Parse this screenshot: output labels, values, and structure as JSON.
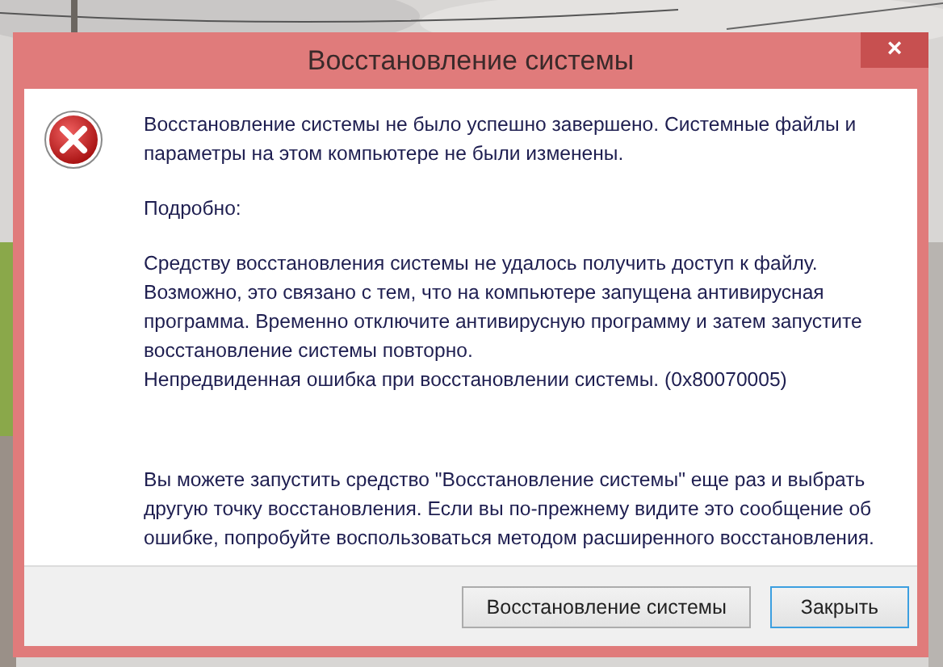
{
  "window": {
    "title": "Восстановление системы",
    "close": "×"
  },
  "message": "Восстановление системы не было успешно завершено. Системные файлы и параметры на этом компьютере не были изменены.",
  "details_label": "Подробно:",
  "details": "Средству восстановления системы не удалось получить доступ к файлу. Возможно, это связано с тем, что на компьютере запущена антивирусная программа. Временно отключите антивирусную программу и затем запустите восстановление системы повторно.",
  "error": "Непредвиденная ошибка при восстановлении системы. (0x80070005)",
  "hint": "Вы можете запустить средство \"Восстановление системы\" еще раз и выбрать другую точку восстановления. Если вы по-прежнему видите это сообщение об ошибке, попробуйте воспользоваться методом расширенного восстановления.",
  "buttons": [
    {
      "label": "Восстановление системы",
      "selected": false
    },
    {
      "label": "Закрыть",
      "selected": true
    }
  ]
}
